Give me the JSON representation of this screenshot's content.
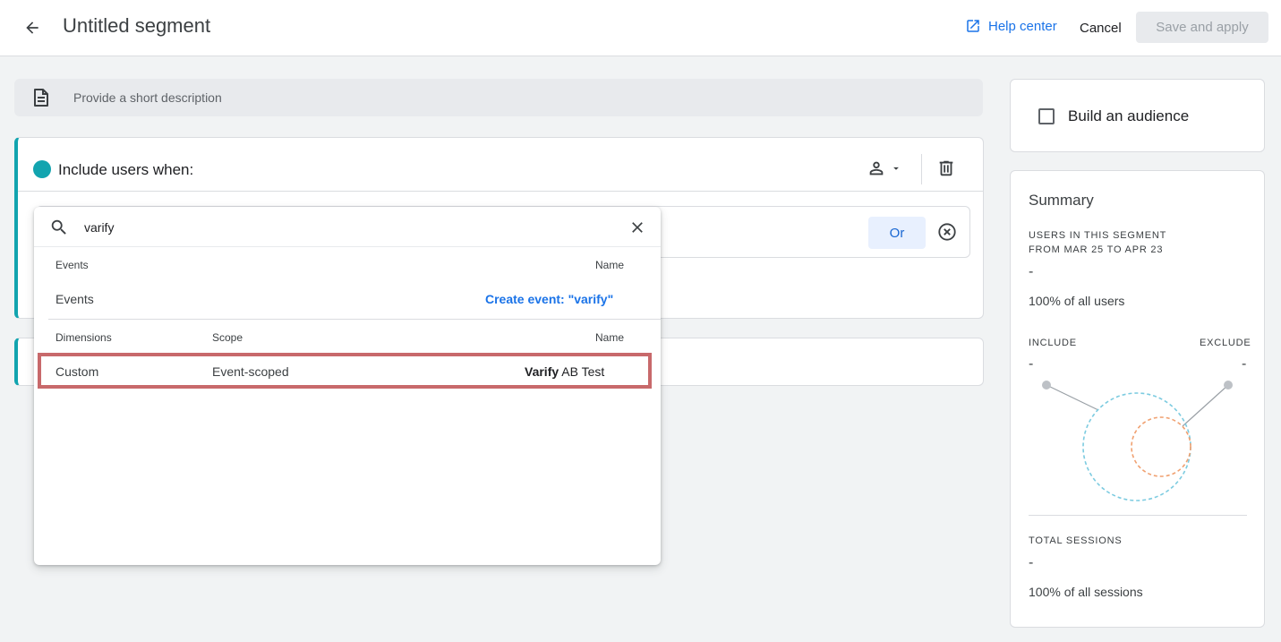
{
  "header": {
    "title": "Untitled segment",
    "help_label": "Help center",
    "cancel_label": "Cancel",
    "save_label": "Save and apply"
  },
  "description": {
    "placeholder": "Provide a short description"
  },
  "include_card": {
    "label": "Include users when:",
    "or_label": "Or"
  },
  "dropdown": {
    "search_value": "varify",
    "events_section": {
      "col_category": "Events",
      "col_name": "Name",
      "row_category": "Events",
      "create_link": "Create event: \"varify\""
    },
    "dimensions_section": {
      "col_category": "Dimensions",
      "col_scope": "Scope",
      "col_name": "Name",
      "rows": [
        {
          "category": "Custom",
          "scope": "Event-scoped",
          "name_match": "Varify",
          "name_rest": " AB Test"
        }
      ]
    }
  },
  "audience": {
    "label": "Build an audience",
    "checked": false
  },
  "summary": {
    "title": "Summary",
    "users_label_line1": "USERS IN THIS SEGMENT",
    "users_label_line2": "FROM MAR 25 TO APR 23",
    "users_value": "-",
    "users_pct": "100% of all users",
    "include_label": "INCLUDE",
    "include_value": "-",
    "exclude_label": "EXCLUDE",
    "exclude_value": "-",
    "sessions_label": "TOTAL SESSIONS",
    "sessions_value": "-",
    "sessions_pct": "100% of all sessions"
  },
  "colors": {
    "accent_teal": "#12a4af",
    "link_blue": "#1a73e8",
    "highlight_red": "#c8696b",
    "include_circle": "#7ccbe0",
    "exclude_circle": "#f0a070"
  }
}
